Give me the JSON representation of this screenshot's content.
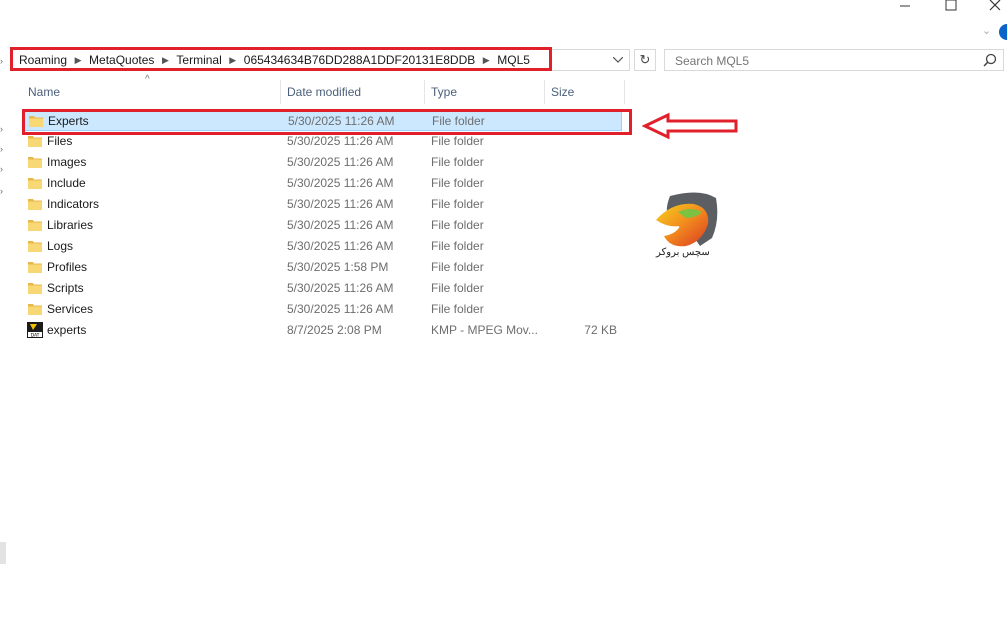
{
  "window": {
    "minimize_icon": "minimize-icon",
    "maximize_icon": "maximize-icon",
    "close_icon": "close-icon"
  },
  "address": {
    "crumbs": [
      "Roaming",
      "MetaQuotes",
      "Terminal",
      "065434634B76DD288A1DDF20131E8DDB",
      "MQL5"
    ]
  },
  "search": {
    "placeholder": "Search MQL5"
  },
  "columns": {
    "name": "Name",
    "date": "Date modified",
    "type": "Type",
    "size": "Size"
  },
  "files": [
    {
      "name": "Experts",
      "date": "5/30/2025 11:26 AM",
      "type": "File folder",
      "size": "",
      "icon": "folder-icon",
      "selected": true
    },
    {
      "name": "Files",
      "date": "5/30/2025 11:26 AM",
      "type": "File folder",
      "size": "",
      "icon": "folder-icon"
    },
    {
      "name": "Images",
      "date": "5/30/2025 11:26 AM",
      "type": "File folder",
      "size": "",
      "icon": "folder-icon"
    },
    {
      "name": "Include",
      "date": "5/30/2025 11:26 AM",
      "type": "File folder",
      "size": "",
      "icon": "folder-icon"
    },
    {
      "name": "Indicators",
      "date": "5/30/2025 11:26 AM",
      "type": "File folder",
      "size": "",
      "icon": "folder-icon"
    },
    {
      "name": "Libraries",
      "date": "5/30/2025 11:26 AM",
      "type": "File folder",
      "size": "",
      "icon": "folder-icon"
    },
    {
      "name": "Logs",
      "date": "5/30/2025 11:26 AM",
      "type": "File folder",
      "size": "",
      "icon": "folder-icon"
    },
    {
      "name": "Profiles",
      "date": "5/30/2025 1:58 PM",
      "type": "File folder",
      "size": "",
      "icon": "folder-icon"
    },
    {
      "name": "Scripts",
      "date": "5/30/2025 11:26 AM",
      "type": "File folder",
      "size": "",
      "icon": "folder-icon"
    },
    {
      "name": "Services",
      "date": "5/30/2025 11:26 AM",
      "type": "File folder",
      "size": "",
      "icon": "folder-icon"
    },
    {
      "name": "experts",
      "date": "8/7/2025 2:08 PM",
      "type": "KMP - MPEG Mov...",
      "size": "72 KB",
      "icon": "dat-file-icon"
    }
  ],
  "watermark": {
    "text": "سچس بروکر"
  },
  "colors": {
    "highlight": "#e0202a",
    "selection": "#cce8ff",
    "folder": "#f8d775",
    "header_text": "#4c607a"
  }
}
